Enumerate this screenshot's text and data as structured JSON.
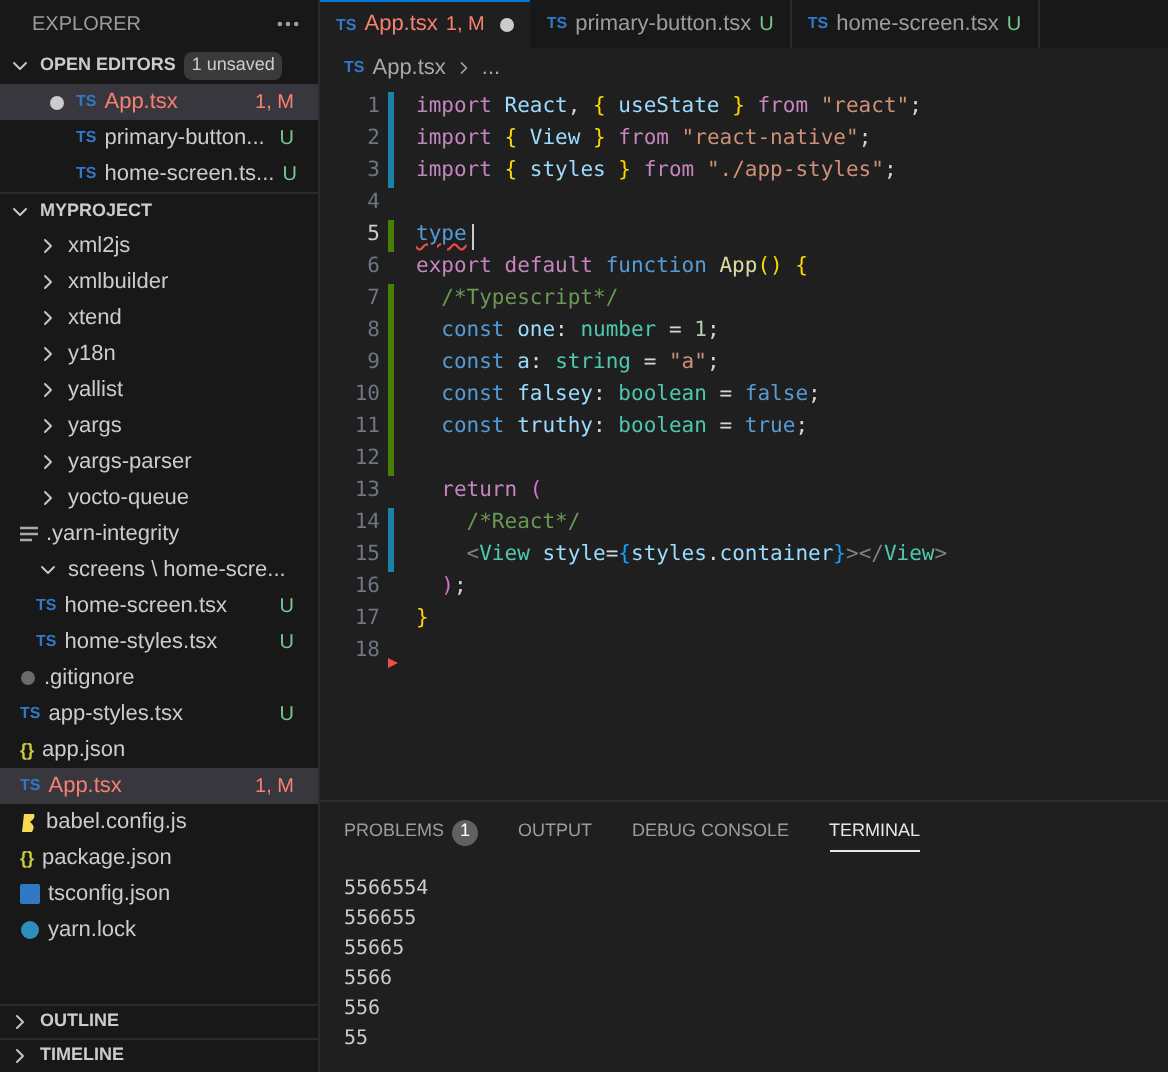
{
  "sidebar": {
    "title": "EXPLORER",
    "open_editors": {
      "label": "OPEN EDITORS",
      "expanded": true,
      "badge": "1 unsaved",
      "items": [
        {
          "name": "App.tsx",
          "icon_label": "TS",
          "kind": "ts",
          "dirty": true,
          "selected": true,
          "problem": true,
          "status": "1, M"
        },
        {
          "name": "primary-button...",
          "icon_label": "TS",
          "kind": "ts",
          "dirty": false,
          "selected": false,
          "problem": false,
          "status": "U"
        },
        {
          "name": "home-screen.ts...",
          "icon_label": "TS",
          "kind": "ts",
          "dirty": false,
          "selected": false,
          "problem": false,
          "status": "U"
        }
      ]
    },
    "project": {
      "label": "MYPROJECT",
      "expanded": true,
      "items": [
        {
          "kind": "folder",
          "name": "xml2js",
          "expanded": false
        },
        {
          "kind": "folder",
          "name": "xmlbuilder",
          "expanded": false
        },
        {
          "kind": "folder",
          "name": "xtend",
          "expanded": false
        },
        {
          "kind": "folder",
          "name": "y18n",
          "expanded": false
        },
        {
          "kind": "folder",
          "name": "yallist",
          "expanded": false
        },
        {
          "kind": "folder",
          "name": "yargs",
          "expanded": false
        },
        {
          "kind": "folder",
          "name": "yargs-parser",
          "expanded": false
        },
        {
          "kind": "folder",
          "name": "yocto-queue",
          "expanded": false
        },
        {
          "kind": "text",
          "name": ".yarn-integrity",
          "selected": false,
          "problem": false
        },
        {
          "kind": "folder",
          "name": "screens \\ home-scre...",
          "expanded": true,
          "modified_dot": true,
          "children": [
            {
              "kind": "ts",
              "icon_label": "TS",
              "name": "home-screen.tsx",
              "status": "U",
              "selected": false,
              "problem": false
            },
            {
              "kind": "ts",
              "icon_label": "TS",
              "name": "home-styles.tsx",
              "status": "U",
              "selected": false,
              "problem": false
            }
          ]
        },
        {
          "kind": "gitignore",
          "name": ".gitignore",
          "selected": false,
          "problem": false
        },
        {
          "kind": "ts",
          "icon_label": "TS",
          "name": "app-styles.tsx",
          "status": "U",
          "selected": false,
          "problem": false
        },
        {
          "kind": "json",
          "icon_label": "{}",
          "name": "app.json",
          "selected": false,
          "problem": false
        },
        {
          "kind": "ts",
          "icon_label": "TS",
          "name": "App.tsx",
          "status": "1, M",
          "selected": true,
          "problem": true
        },
        {
          "kind": "babel",
          "name": "babel.config.js",
          "selected": false,
          "problem": false
        },
        {
          "kind": "json",
          "icon_label": "{}",
          "name": "package.json",
          "selected": false,
          "problem": false
        },
        {
          "kind": "tsconfig",
          "name": "tsconfig.json",
          "selected": false,
          "problem": false
        },
        {
          "kind": "yarn",
          "name": "yarn.lock",
          "selected": false,
          "problem": false
        }
      ]
    },
    "bottom_sections": [
      {
        "label": "OUTLINE",
        "expanded": false
      },
      {
        "label": "TIMELINE",
        "expanded": false
      }
    ]
  },
  "tabs": [
    {
      "icon_label": "TS",
      "name": "App.tsx",
      "status": "1, M",
      "dirty": true,
      "problem": true,
      "selected": true
    },
    {
      "icon_label": "TS",
      "name": "primary-button.tsx",
      "status": "U",
      "dirty": false,
      "problem": false,
      "selected": false
    },
    {
      "icon_label": "TS",
      "name": "home-screen.tsx",
      "status": "U",
      "dirty": false,
      "problem": false,
      "selected": false
    }
  ],
  "breadcrumb": {
    "icon_label": "TS",
    "items": [
      "App.tsx",
      "..."
    ]
  },
  "code": [
    {
      "number": "1",
      "modified": true,
      "added": false,
      "deleted": false,
      "tokens": [
        {
          "text": "import",
          "kind": "kw"
        },
        {
          "text": " React",
          "kind": "var"
        },
        {
          "text": ", ",
          "kind": "p"
        },
        {
          "text": "{",
          "kind": "b1"
        },
        {
          "text": " useState ",
          "kind": "var"
        },
        {
          "text": "}",
          "kind": "b1"
        },
        {
          "text": " from ",
          "kind": "kw"
        },
        {
          "text": "\"react\"",
          "kind": "str"
        },
        {
          "text": ";",
          "kind": "p"
        }
      ]
    },
    {
      "number": "2",
      "modified": true,
      "added": false,
      "deleted": false,
      "tokens": [
        {
          "text": "import ",
          "kind": "kw"
        },
        {
          "text": "{",
          "kind": "b1"
        },
        {
          "text": " View ",
          "kind": "var"
        },
        {
          "text": "}",
          "kind": "b1"
        },
        {
          "text": " from ",
          "kind": "kw"
        },
        {
          "text": "\"react-native\"",
          "kind": "str"
        },
        {
          "text": ";",
          "kind": "p"
        }
      ]
    },
    {
      "number": "3",
      "modified": true,
      "added": false,
      "deleted": false,
      "tokens": [
        {
          "text": "import ",
          "kind": "kw"
        },
        {
          "text": "{",
          "kind": "b1"
        },
        {
          "text": " styles ",
          "kind": "var"
        },
        {
          "text": "}",
          "kind": "b1"
        },
        {
          "text": " from ",
          "kind": "kw"
        },
        {
          "text": "\"./app-styles\"",
          "kind": "str"
        },
        {
          "text": ";",
          "kind": "p"
        }
      ]
    },
    {
      "number": "4",
      "modified": false,
      "added": false,
      "deleted": false
    },
    {
      "number": "5",
      "modified": false,
      "added": true,
      "deleted": false,
      "cursor": true,
      "tokens": [
        {
          "text": "type",
          "kind": "err"
        }
      ]
    },
    {
      "number": "6",
      "modified": false,
      "added": false,
      "deleted": false,
      "tokens": [
        {
          "text": "export default ",
          "kind": "kw"
        },
        {
          "text": "function ",
          "kind": "st"
        },
        {
          "text": "App",
          "kind": "fn"
        },
        {
          "text": "() {",
          "kind": "b1"
        }
      ]
    },
    {
      "number": "7",
      "modified": false,
      "added": true,
      "deleted": false,
      "tokens": [
        {
          "text": "  /*Typescript*/",
          "kind": "cm"
        }
      ]
    },
    {
      "number": "8",
      "modified": false,
      "added": true,
      "deleted": false,
      "tokens": [
        {
          "text": "  const ",
          "kind": "st"
        },
        {
          "text": "one",
          "kind": "var"
        },
        {
          "text": ": ",
          "kind": "p"
        },
        {
          "text": "number",
          "kind": "ty"
        },
        {
          "text": " = ",
          "kind": "p"
        },
        {
          "text": "1",
          "kind": "num"
        },
        {
          "text": ";",
          "kind": "p"
        }
      ]
    },
    {
      "number": "9",
      "modified": false,
      "added": true,
      "deleted": false,
      "tokens": [
        {
          "text": "  const ",
          "kind": "st"
        },
        {
          "text": "a",
          "kind": "var"
        },
        {
          "text": ": ",
          "kind": "p"
        },
        {
          "text": "string",
          "kind": "ty"
        },
        {
          "text": " = ",
          "kind": "p"
        },
        {
          "text": "\"a\"",
          "kind": "str"
        },
        {
          "text": ";",
          "kind": "p"
        }
      ]
    },
    {
      "number": "10",
      "modified": false,
      "added": true,
      "deleted": false,
      "tokens": [
        {
          "text": "  const ",
          "kind": "st"
        },
        {
          "text": "falsey",
          "kind": "var"
        },
        {
          "text": ": ",
          "kind": "p"
        },
        {
          "text": "boolean",
          "kind": "ty"
        },
        {
          "text": " = ",
          "kind": "p"
        },
        {
          "text": "false",
          "kind": "st"
        },
        {
          "text": ";",
          "kind": "p"
        }
      ]
    },
    {
      "number": "11",
      "modified": false,
      "added": true,
      "deleted": false,
      "tokens": [
        {
          "text": "  const ",
          "kind": "st"
        },
        {
          "text": "truthy",
          "kind": "var"
        },
        {
          "text": ": ",
          "kind": "p"
        },
        {
          "text": "boolean",
          "kind": "ty"
        },
        {
          "text": " = ",
          "kind": "p"
        },
        {
          "text": "true",
          "kind": "st"
        },
        {
          "text": ";",
          "kind": "p"
        }
      ]
    },
    {
      "number": "12",
      "modified": false,
      "added": true,
      "deleted": false
    },
    {
      "number": "13",
      "modified": false,
      "added": false,
      "deleted": false,
      "tokens": [
        {
          "text": "  return ",
          "kind": "kw"
        },
        {
          "text": "(",
          "kind": "b2"
        }
      ]
    },
    {
      "number": "14",
      "modified": true,
      "added": false,
      "deleted": false,
      "tokens": [
        {
          "text": "    /*React*/",
          "kind": "cm"
        }
      ]
    },
    {
      "number": "15",
      "modified": true,
      "added": false,
      "deleted": false,
      "tokens": [
        {
          "text": "    <",
          "kind": "tp"
        },
        {
          "text": "View",
          "kind": "ty"
        },
        {
          "text": " style",
          "kind": "var"
        },
        {
          "text": "=",
          "kind": "p"
        },
        {
          "text": "{",
          "kind": "b3"
        },
        {
          "text": "styles",
          "kind": "var"
        },
        {
          "text": ".",
          "kind": "p"
        },
        {
          "text": "container",
          "kind": "var"
        },
        {
          "text": "}",
          "kind": "b3"
        },
        {
          "text": "></",
          "kind": "tp"
        },
        {
          "text": "View",
          "kind": "ty"
        },
        {
          "text": ">",
          "kind": "tp"
        }
      ]
    },
    {
      "number": "16",
      "modified": false,
      "added": false,
      "deleted": false,
      "tokens": [
        {
          "text": "  )",
          "kind": "b2"
        },
        {
          "text": ";",
          "kind": "p"
        }
      ]
    },
    {
      "number": "17",
      "modified": false,
      "added": false,
      "deleted": false,
      "tokens": [
        {
          "text": "}",
          "kind": "b1"
        }
      ]
    },
    {
      "number": "18",
      "modified": false,
      "added": false,
      "deleted": true
    }
  ],
  "panel": {
    "tabs": [
      {
        "label": "PROBLEMS",
        "badge": "1",
        "selected": false
      },
      {
        "label": "OUTPUT",
        "selected": false
      },
      {
        "label": "DEBUG CONSOLE",
        "selected": false
      },
      {
        "label": "TERMINAL",
        "selected": true
      }
    ],
    "terminal_lines": [
      "5566554",
      "556655",
      "55665",
      "5566",
      "556",
      "55"
    ]
  }
}
